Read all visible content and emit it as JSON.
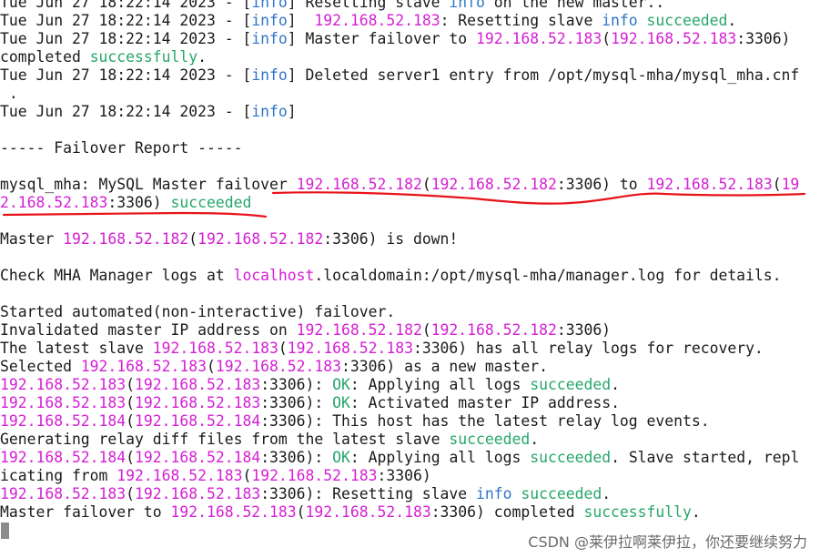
{
  "terminal": {
    "lines": [
      [
        [
          "plain",
          "Tue Jun 27 18:22:14 2023 - ["
        ],
        [
          "info",
          "info"
        ],
        [
          "plain",
          "] Resetting slave "
        ],
        [
          "info",
          "info"
        ],
        [
          "plain",
          " on the new master.."
        ]
      ],
      [
        [
          "plain",
          "Tue Jun 27 18:22:14 2023 - ["
        ],
        [
          "info",
          "info"
        ],
        [
          "plain",
          "]  "
        ],
        [
          "ip",
          "192.168.52.183"
        ],
        [
          "plain",
          ": Resetting slave "
        ],
        [
          "info",
          "info"
        ],
        [
          "plain",
          " "
        ],
        [
          "ok",
          "succeeded"
        ],
        [
          "plain",
          "."
        ]
      ],
      [
        [
          "plain",
          "Tue Jun 27 18:22:14 2023 - ["
        ],
        [
          "info",
          "info"
        ],
        [
          "plain",
          "] Master failover to "
        ],
        [
          "ip",
          "192.168.52.183"
        ],
        [
          "plain",
          "("
        ],
        [
          "ip",
          "192.168.52.183"
        ],
        [
          "plain",
          ":3306)"
        ]
      ],
      [
        [
          "plain",
          "completed "
        ],
        [
          "ok",
          "successfully"
        ],
        [
          "plain",
          "."
        ]
      ],
      [
        [
          "plain",
          "Tue Jun 27 18:22:14 2023 - ["
        ],
        [
          "info",
          "info"
        ],
        [
          "plain",
          "] Deleted server1 entry from /opt/mysql-mha/mysql_mha.cnf"
        ]
      ],
      [
        [
          "plain",
          " ."
        ]
      ],
      [
        [
          "plain",
          "Tue Jun 27 18:22:14 2023 - ["
        ],
        [
          "info",
          "info"
        ],
        [
          "plain",
          "]"
        ]
      ],
      [],
      [
        [
          "plain",
          "----- Failover Report -----"
        ]
      ],
      [],
      [
        [
          "plain",
          "mysql_mha: MySQL Master failover "
        ],
        [
          "ip",
          "192.168.52.182"
        ],
        [
          "plain",
          "("
        ],
        [
          "ip",
          "192.168.52.182"
        ],
        [
          "plain",
          ":3306) to "
        ],
        [
          "ip",
          "192.168.52.183"
        ],
        [
          "plain",
          "("
        ],
        [
          "ip",
          "19"
        ]
      ],
      [
        [
          "ip",
          "2.168.52.183"
        ],
        [
          "plain",
          ":3306) "
        ],
        [
          "ok",
          "succeeded"
        ]
      ],
      [],
      [
        [
          "plain",
          "Master "
        ],
        [
          "ip",
          "192.168.52.182"
        ],
        [
          "plain",
          "("
        ],
        [
          "ip",
          "192.168.52.182"
        ],
        [
          "plain",
          ":3306) is down!"
        ]
      ],
      [],
      [
        [
          "plain",
          "Check MHA Manager logs at "
        ],
        [
          "host",
          "localhost"
        ],
        [
          "plain",
          ".localdomain:/opt/mysql-mha/manager.log for details."
        ]
      ],
      [],
      [
        [
          "plain",
          "Started automated(non-interactive) failover."
        ]
      ],
      [
        [
          "plain",
          "Invalidated master IP address on "
        ],
        [
          "ip",
          "192.168.52.182"
        ],
        [
          "plain",
          "("
        ],
        [
          "ip",
          "192.168.52.182"
        ],
        [
          "plain",
          ":3306)"
        ]
      ],
      [
        [
          "plain",
          "The latest slave "
        ],
        [
          "ip",
          "192.168.52.183"
        ],
        [
          "plain",
          "("
        ],
        [
          "ip",
          "192.168.52.183"
        ],
        [
          "plain",
          ":3306) has all relay logs for recovery."
        ]
      ],
      [
        [
          "plain",
          "Selected "
        ],
        [
          "ip",
          "192.168.52.183"
        ],
        [
          "plain",
          "("
        ],
        [
          "ip",
          "192.168.52.183"
        ],
        [
          "plain",
          ":3306) as a new master."
        ]
      ],
      [
        [
          "ip",
          "192.168.52.183"
        ],
        [
          "plain",
          "("
        ],
        [
          "ip",
          "192.168.52.183"
        ],
        [
          "plain",
          ":3306): "
        ],
        [
          "ok",
          "OK"
        ],
        [
          "plain",
          ": Applying all logs "
        ],
        [
          "ok",
          "succeeded"
        ],
        [
          "plain",
          "."
        ]
      ],
      [
        [
          "ip",
          "192.168.52.183"
        ],
        [
          "plain",
          "("
        ],
        [
          "ip",
          "192.168.52.183"
        ],
        [
          "plain",
          ":3306): "
        ],
        [
          "ok",
          "OK"
        ],
        [
          "plain",
          ": Activated master IP address."
        ]
      ],
      [
        [
          "ip",
          "192.168.52.184"
        ],
        [
          "plain",
          "("
        ],
        [
          "ip",
          "192.168.52.184"
        ],
        [
          "plain",
          ":3306): This host has the latest relay log events."
        ]
      ],
      [
        [
          "plain",
          "Generating relay diff files from the latest slave "
        ],
        [
          "ok",
          "succeeded"
        ],
        [
          "plain",
          "."
        ]
      ],
      [
        [
          "ip",
          "192.168.52.184"
        ],
        [
          "plain",
          "("
        ],
        [
          "ip",
          "192.168.52.184"
        ],
        [
          "plain",
          ":3306): "
        ],
        [
          "ok",
          "OK"
        ],
        [
          "plain",
          ": Applying all logs "
        ],
        [
          "ok",
          "succeeded"
        ],
        [
          "plain",
          ". Slave started, repl"
        ]
      ],
      [
        [
          "plain",
          "icating from "
        ],
        [
          "ip",
          "192.168.52.183"
        ],
        [
          "plain",
          "("
        ],
        [
          "ip",
          "192.168.52.183"
        ],
        [
          "plain",
          ":3306)"
        ]
      ],
      [
        [
          "ip",
          "192.168.52.183"
        ],
        [
          "plain",
          "("
        ],
        [
          "ip",
          "192.168.52.183"
        ],
        [
          "plain",
          ":3306): Resetting slave "
        ],
        [
          "info",
          "info"
        ],
        [
          "plain",
          " "
        ],
        [
          "ok",
          "succeeded"
        ],
        [
          "plain",
          "."
        ]
      ],
      [
        [
          "plain",
          "Master failover to "
        ],
        [
          "ip",
          "192.168.52.183"
        ],
        [
          "plain",
          "("
        ],
        [
          "ip",
          "192.168.52.183"
        ],
        [
          "plain",
          ":3306) completed "
        ],
        [
          "ok",
          "successfully"
        ],
        [
          "plain",
          "."
        ]
      ]
    ]
  },
  "colors": {
    "background": "#ffffff",
    "text": "#1a1a1a",
    "ip": "#d41fd4",
    "info": "#2f74c9",
    "ok": "#27a66a",
    "annotation": "#e8131b",
    "cursor": "#8c8c8c"
  },
  "annotation": {
    "description": "hand-drawn red underline marks"
  },
  "watermark": {
    "text": "CSDN @莱伊拉啊莱伊拉，你还要继续努力"
  }
}
